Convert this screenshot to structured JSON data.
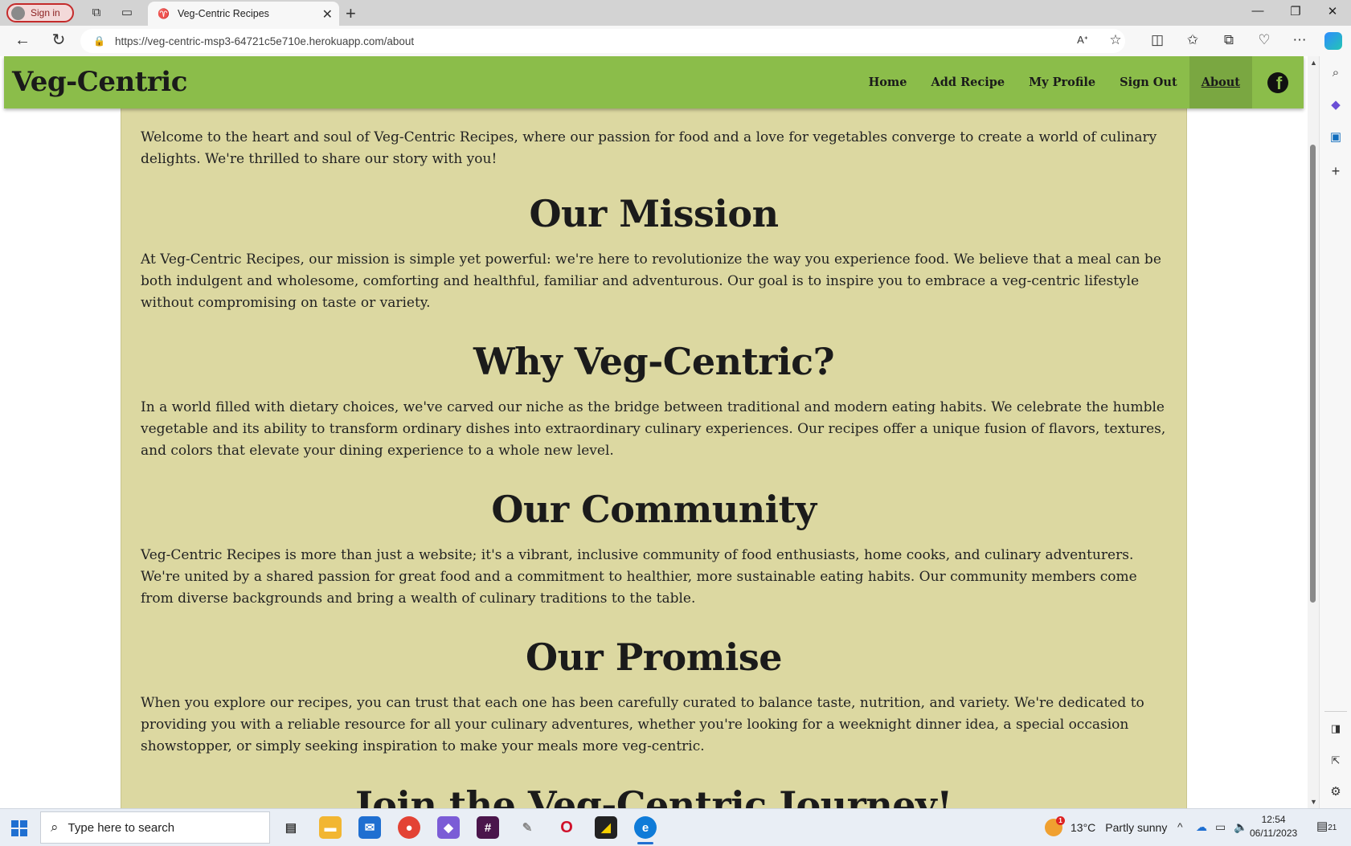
{
  "browser": {
    "signin_label": "Sign in",
    "tab_title": "Veg-Centric Recipes",
    "url": "https://veg-centric-msp3-64721c5e710e.herokuapp.com/about"
  },
  "site": {
    "brand": "Veg-Centric",
    "nav": [
      {
        "label": "Home",
        "active": false
      },
      {
        "label": "Add Recipe",
        "active": false
      },
      {
        "label": "My Profile",
        "active": false
      },
      {
        "label": "Sign Out",
        "active": false
      },
      {
        "label": "About",
        "active": true
      }
    ],
    "colors": {
      "nav_bg": "#8bbd4a",
      "card_bg": "#dcd8a1",
      "active_nav": "#7aa741"
    }
  },
  "about": {
    "intro": "Welcome to the heart and soul of Veg-Centric Recipes, where our passion for food and a love for vegetables converge to create a world of culinary delights. We're thrilled to share our story with you!",
    "sections": [
      {
        "heading": "Our Mission",
        "text": "At Veg-Centric Recipes, our mission is simple yet powerful: we're here to revolutionize the way you experience food. We believe that a meal can be both indulgent and wholesome, comforting and healthful, familiar and adventurous. Our goal is to inspire you to embrace a veg-centric lifestyle without compromising on taste or variety."
      },
      {
        "heading": "Why Veg-Centric?",
        "text": "In a world filled with dietary choices, we've carved our niche as the bridge between traditional and modern eating habits. We celebrate the humble vegetable and its ability to transform ordinary dishes into extraordinary culinary experiences. Our recipes offer a unique fusion of flavors, textures, and colors that elevate your dining experience to a whole new level."
      },
      {
        "heading": "Our Community",
        "text": "Veg-Centric Recipes is more than just a website; it's a vibrant, inclusive community of food enthusiasts, home cooks, and culinary adventurers. We're united by a shared passion for great food and a commitment to healthier, more sustainable eating habits. Our community members come from diverse backgrounds and bring a wealth of culinary traditions to the table."
      },
      {
        "heading": "Our Promise",
        "text": "When you explore our recipes, you can trust that each one has been carefully curated to balance taste, nutrition, and variety. We're dedicated to providing you with a reliable resource for all your culinary adventures, whether you're looking for a weeknight dinner idea, a special occasion showstopper, or simply seeking inspiration to make your meals more veg-centric."
      }
    ],
    "last_heading": "Join the Veg-Centric Journey!"
  },
  "taskbar": {
    "search_placeholder": "Type here to search",
    "weather_temp": "13°C",
    "weather_desc": "Partly sunny",
    "weather_badge": "1",
    "time": "12:54",
    "date": "06/11/2023",
    "notification_count": "21"
  }
}
